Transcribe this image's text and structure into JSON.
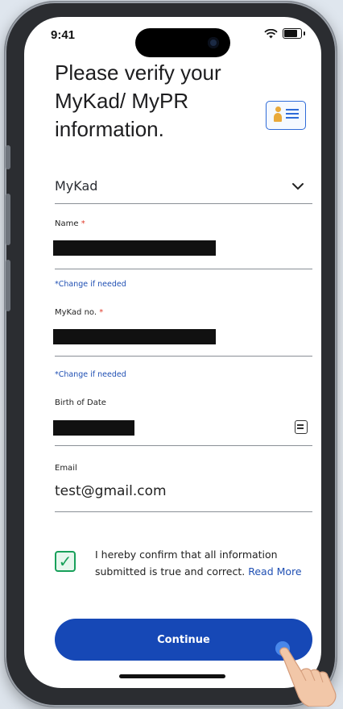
{
  "status": {
    "time": "9:41"
  },
  "page": {
    "title": "Please verify your MyKad/ MyPR information."
  },
  "id_type": {
    "selected": "MyKad"
  },
  "fields": {
    "name": {
      "label": "Name",
      "required_mark": "*",
      "hint": "*Change if needed"
    },
    "mykad_no": {
      "label": "MyKad no.",
      "required_mark": "*",
      "hint": "*Change if needed"
    },
    "birth_date": {
      "label": "Birth of Date"
    },
    "email": {
      "label": "Email",
      "value": "test@gmail.com"
    }
  },
  "consent": {
    "checked": true,
    "text": "I hereby confirm that all information submitted is true and correct.",
    "link": "Read More"
  },
  "actions": {
    "continue_label": "Continue"
  },
  "colors": {
    "primary": "#1648b6",
    "link": "#1f4fb3",
    "check": "#18a05a",
    "required": "#e03b2b"
  },
  "icons": [
    "wifi-icon",
    "battery-icon",
    "id-card-icon",
    "chevron-down-icon",
    "calendar-icon",
    "checkmark-icon",
    "pointing-hand-icon"
  ]
}
